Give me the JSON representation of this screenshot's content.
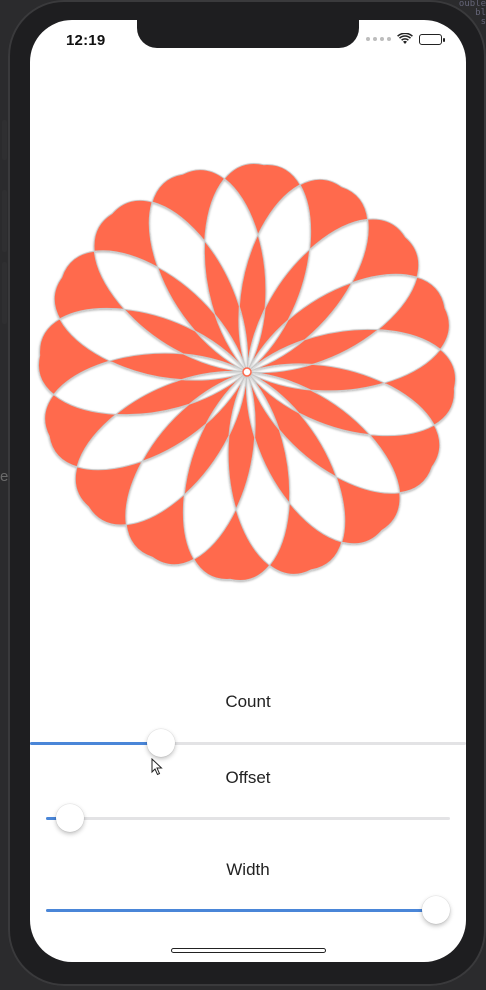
{
  "status_bar": {
    "time": "12:19"
  },
  "flower": {
    "petal_color": "#ff6a4d",
    "background_color": "#ffffff"
  },
  "sliders": [
    {
      "label": "Count",
      "value": 0.3
    },
    {
      "label": "Offset",
      "value": 0.06
    },
    {
      "label": "Width",
      "value": 1.0
    }
  ],
  "colors": {
    "slider_fill": "#4a86d8",
    "slider_track": "#e3e3e5"
  }
}
